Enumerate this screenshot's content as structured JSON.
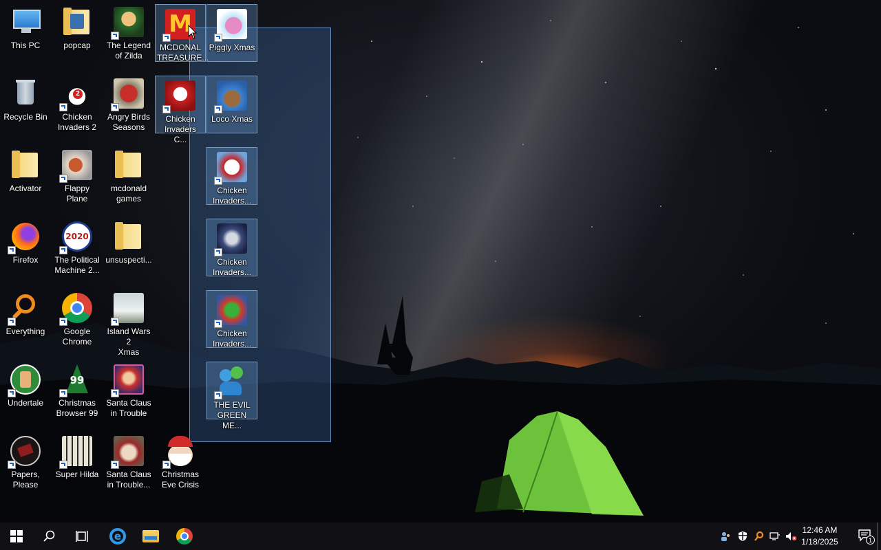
{
  "desktop": {
    "icons": [
      {
        "id": "this-pc",
        "label": "This PC"
      },
      {
        "id": "popcap",
        "label": "popcap"
      },
      {
        "id": "legend-zilda",
        "label": "The Legend\nof Zilda"
      },
      {
        "id": "mcdonald-treasure",
        "label": "MCDONAL\nTREASURE..."
      },
      {
        "id": "piggly-xmas",
        "label": "Piggly Xmas"
      },
      {
        "id": "recycle-bin",
        "label": "Recycle Bin"
      },
      {
        "id": "chicken-invaders-2",
        "label": "Chicken\nInvaders 2"
      },
      {
        "id": "angry-birds-seasons",
        "label": "Angry Birds\nSeasons"
      },
      {
        "id": "chicken-invaders-c",
        "label": "Chicken\nInvaders C..."
      },
      {
        "id": "loco-xmas",
        "label": "Loco Xmas"
      },
      {
        "id": "activator",
        "label": "Activator"
      },
      {
        "id": "flappy-plane",
        "label": "Flappy Plane"
      },
      {
        "id": "mcdonald-games",
        "label": "mcdonald\ngames"
      },
      {
        "id": "chicken-invaders-a",
        "label": "Chicken\nInvaders..."
      },
      {
        "id": "firefox",
        "label": "Firefox"
      },
      {
        "id": "political-machine",
        "label": "The Political\nMachine 2..."
      },
      {
        "id": "unsuspecti",
        "label": "unsuspecti..."
      },
      {
        "id": "chicken-invaders-b",
        "label": "Chicken\nInvaders..."
      },
      {
        "id": "everything",
        "label": "Everything"
      },
      {
        "id": "google-chrome",
        "label": "Google\nChrome"
      },
      {
        "id": "island-wars",
        "label": "Island Wars 2\nXmas"
      },
      {
        "id": "chicken-invaders-d",
        "label": "Chicken\nInvaders..."
      },
      {
        "id": "undertale",
        "label": "Undertale"
      },
      {
        "id": "christmas-browser",
        "label": "Christmas\nBrowser 99"
      },
      {
        "id": "santa-trouble",
        "label": "Santa Claus\nin Trouble"
      },
      {
        "id": "evil-green",
        "label": "THE EVIL\nGREEN ME..."
      },
      {
        "id": "papers-please",
        "label": "Papers,\nPlease"
      },
      {
        "id": "super-hilda",
        "label": "Super Hilda"
      },
      {
        "id": "santa-trouble-2",
        "label": "Santa Claus\nin Trouble..."
      },
      {
        "id": "christmas-eve-crisis",
        "label": "Christmas\nEve Crisis"
      }
    ],
    "icon_badges": {
      "christmas_browser": "99",
      "political_machine": "2020",
      "chicken_invaders_2": "2"
    }
  },
  "taskbar": {
    "clock_time": "12:46 AM",
    "clock_date": "1/18/2025",
    "notification_count": "1",
    "pinned": [
      "start-icon",
      "search-icon",
      "task-view-icon",
      "internet-explorer-icon",
      "file-explorer-icon",
      "chrome-icon"
    ]
  },
  "colors": {
    "selection": "#4678be",
    "taskbar": "#121216",
    "tent": "#7ad13a"
  }
}
